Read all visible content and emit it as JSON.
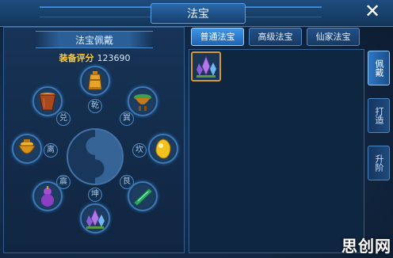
{
  "window": {
    "title": "法宝",
    "close_glyph": "✕"
  },
  "left": {
    "subtitle": "法宝佩戴",
    "score_label": "装备评分",
    "score_value": "123690",
    "trigrams": [
      "乾",
      "巽",
      "坎",
      "艮",
      "坤",
      "震",
      "离",
      "兑"
    ],
    "slots": [
      {
        "name": "bell-icon",
        "filled": true
      },
      {
        "name": "cauldron-icon",
        "filled": true
      },
      {
        "name": "gem-orb-icon",
        "filled": true
      },
      {
        "name": "jade-tablet-icon",
        "filled": true
      },
      {
        "name": "crystal-cluster-icon",
        "filled": true
      },
      {
        "name": "gourd-icon",
        "filled": true
      },
      {
        "name": "golden-pot-icon",
        "filled": true
      },
      {
        "name": "brown-cup-icon",
        "filled": true
      }
    ]
  },
  "tabs": [
    {
      "label": "普通法宝",
      "active": true
    },
    {
      "label": "高级法宝",
      "active": false
    },
    {
      "label": "仙家法宝",
      "active": false
    }
  ],
  "inventory": [
    {
      "name": "crystal-cluster-icon"
    }
  ],
  "side_tabs": [
    {
      "label": "佩戴",
      "active": true
    },
    {
      "label": "打造",
      "active": false
    },
    {
      "label": "升阶",
      "active": false
    }
  ],
  "watermark": "思创网",
  "colors": {
    "accent": "#3f95e6",
    "gold": "#ffcc33",
    "border": "#4d8bd0"
  }
}
